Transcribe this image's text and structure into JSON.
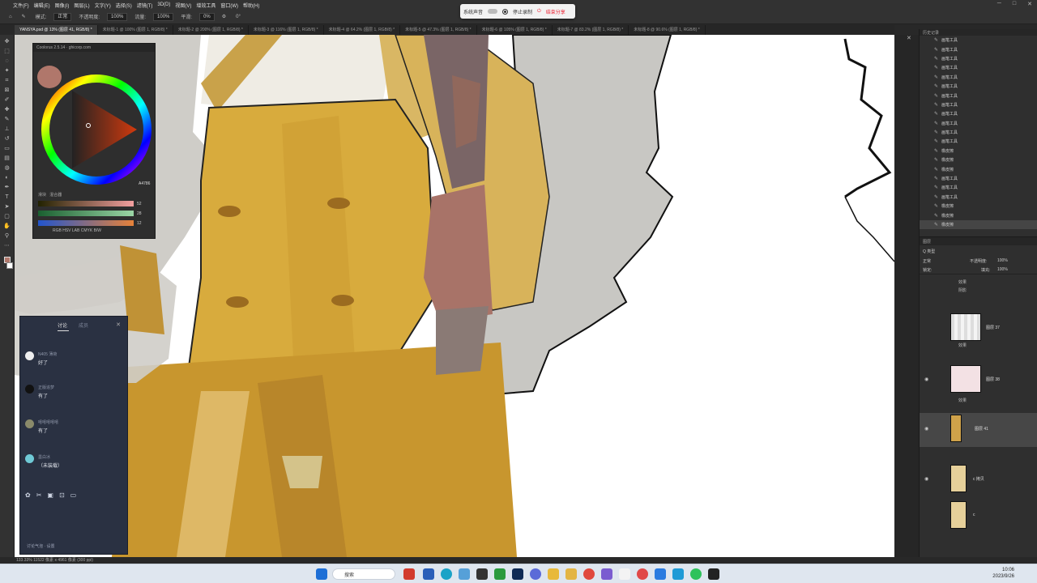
{
  "menubar": {
    "items": [
      "文件(F)",
      "编辑(E)",
      "图像(I)",
      "图层(L)",
      "文字(Y)",
      "选择(S)",
      "滤镜(T)",
      "3D(D)",
      "视图(V)",
      "增效工具",
      "窗口(W)",
      "帮助(H)"
    ]
  },
  "options": {
    "mode_label": "模式:",
    "mode_value": "正常",
    "opacity_label": "不透明度:",
    "opacity_value": "100%",
    "flow_label": "流量:",
    "flow_value": "100%",
    "smooth_label": "平滑:",
    "smooth_value": "0%",
    "angle_value": "0°"
  },
  "recording": {
    "sound_label": "系统声音",
    "stop_label": "停止录制",
    "share_label": "结束分享"
  },
  "tabs": [
    {
      "label": "YANSYA.psd @ 13% (图层 41, RGB/8) *",
      "active": true
    },
    {
      "label": "未标题-1 @ 100% (图层 1, RGB/8) *"
    },
    {
      "label": "未标题-2 @ 200% (图层 1, RGB/8) *"
    },
    {
      "label": "未标题-3 @ 116% (图层 1, RGB/8) *"
    },
    {
      "label": "未标题-4 @ 64.2% (图层 1, RGB/8) *"
    },
    {
      "label": "未标题-5 @ 47.3% (图层 1, RGB/8) *"
    },
    {
      "label": "未标题-6 @ 105% (图层 1, RGB/8) *"
    },
    {
      "label": "未标题-7 @ 83.2% (图层 1, RGB/8) *"
    },
    {
      "label": "未标题-8 @ 90.6% (图层 1, RGB/8) *"
    }
  ],
  "colors": {
    "foreground": "#b0776b",
    "background": "#ffffff",
    "hex_value": "A4786"
  },
  "coolorus": {
    "title": "Coolorus 2.5.14 · ghicorp.com",
    "tab_sliders": "滑块",
    "tab_mixer": "混合器",
    "sliders": [
      {
        "name": "R",
        "value": "52"
      },
      {
        "name": "G",
        "value": "28"
      },
      {
        "name": "B",
        "value": "12"
      }
    ],
    "modes": "RGB  HSV  LAB  CMYK  B/W"
  },
  "chat": {
    "tab_discuss": "讨论",
    "tab_other": "成员",
    "messages": [
      {
        "name": "N405 薄荷",
        "text": "好了"
      },
      {
        "name": "正版追梦",
        "text": "有了"
      },
      {
        "name": "嘻嘻嘻嘻嘻",
        "text": "有了"
      },
      {
        "name": "墨白冰",
        "text": "（未装载）"
      }
    ],
    "footer": "讨论气泡  ·  设置"
  },
  "history": {
    "title": "历史记录",
    "items": [
      "画笔工具",
      "画笔工具",
      "画笔工具",
      "画笔工具",
      "画笔工具",
      "画笔工具",
      "画笔工具",
      "画笔工具",
      "画笔工具",
      "画笔工具",
      "画笔工具",
      "画笔工具",
      "橡皮擦",
      "橡皮擦",
      "橡皮擦",
      "画笔工具",
      "画笔工具",
      "画笔工具",
      "橡皮擦",
      "橡皮擦",
      "橡皮擦"
    ]
  },
  "layers": {
    "title": "图层",
    "kind_label": "Q 类型",
    "blend": "正常",
    "opacity_label": "不透明度:",
    "opacity_value": "100%",
    "lock_label": "锁定:",
    "fill_label": "填充:",
    "fill_value": "100%",
    "effect_label": "效果",
    "shadow_label": "阴影",
    "rows": [
      {
        "name": "图层 37"
      },
      {
        "name": "图层 38"
      },
      {
        "name": "图层 41"
      },
      {
        "name": "c 拷贝"
      },
      {
        "name": "c"
      }
    ]
  },
  "status": {
    "text": "133.33%  11522 像素 x 4961 像素 (300 ppi)"
  },
  "taskbar": {
    "search_placeholder": "搜索",
    "time": "10:06",
    "date": "2023/9/26"
  }
}
